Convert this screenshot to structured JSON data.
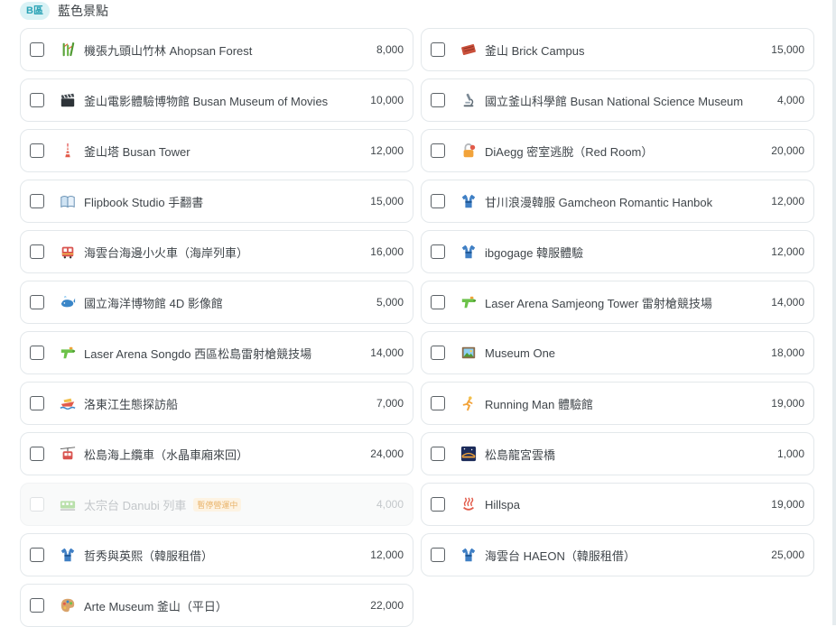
{
  "section": {
    "badge": "B區",
    "title": "藍色景點"
  },
  "status_tag_suspended": "暫停營運中",
  "items": [
    {
      "label": "機張九頭山竹林 Ahopsan Forest",
      "price": "8,000",
      "icon": "bamboo-icon",
      "disabled": false
    },
    {
      "label": "釜山 Brick Campus",
      "price": "15,000",
      "icon": "brick-icon",
      "disabled": false
    },
    {
      "label": "釜山電影體驗博物館 Busan Museum of Movies",
      "price": "10,000",
      "icon": "clapperboard-icon",
      "disabled": false
    },
    {
      "label": "國立釜山科學館 Busan National Science Museum",
      "price": "4,000",
      "icon": "microscope-icon",
      "disabled": false
    },
    {
      "label": "釜山塔 Busan Tower",
      "price": "12,000",
      "icon": "tower-icon",
      "disabled": false
    },
    {
      "label": "DiAegg 密室逃脫（Red Room）",
      "price": "20,000",
      "icon": "lock-icon",
      "disabled": false
    },
    {
      "label": "Flipbook Studio 手翻書",
      "price": "15,000",
      "icon": "book-icon",
      "disabled": false
    },
    {
      "label": "甘川浪漫韓服 Gamcheon Romantic Hanbok",
      "price": "12,000",
      "icon": "kimono-icon",
      "disabled": false
    },
    {
      "label": "海雲台海邊小火車（海岸列車）",
      "price": "16,000",
      "icon": "tram-icon",
      "disabled": false
    },
    {
      "label": "ibgogage 韓服體驗",
      "price": "12,000",
      "icon": "kimono-icon",
      "disabled": false
    },
    {
      "label": "國立海洋博物館 4D 影像館",
      "price": "5,000",
      "icon": "whale-icon",
      "disabled": false
    },
    {
      "label": "Laser Arena Samjeong Tower 雷射槍競技場",
      "price": "14,000",
      "icon": "water-gun-icon",
      "disabled": false
    },
    {
      "label": "Laser Arena Songdo 西區松島雷射槍競技場",
      "price": "14,000",
      "icon": "water-gun-icon",
      "disabled": false
    },
    {
      "label": "Museum One",
      "price": "18,000",
      "icon": "framed-picture-icon",
      "disabled": false
    },
    {
      "label": "洛東江生態探訪船",
      "price": "7,000",
      "icon": "boat-icon",
      "disabled": false
    },
    {
      "label": "Running Man 體驗館",
      "price": "19,000",
      "icon": "runner-icon",
      "disabled": false
    },
    {
      "label": "松島海上纜車（水晶車廂來回）",
      "price": "24,000",
      "icon": "cable-car-icon",
      "disabled": false
    },
    {
      "label": "松島龍宮雲橋",
      "price": "1,000",
      "icon": "bridge-night-icon",
      "disabled": false
    },
    {
      "label": "太宗台 Danubi 列車",
      "price": "4,000",
      "icon": "train-icon",
      "disabled": true
    },
    {
      "label": "Hillspa",
      "price": "19,000",
      "icon": "hot-springs-icon",
      "disabled": false
    },
    {
      "label": "哲秀與英熙（韓服租借）",
      "price": "12,000",
      "icon": "kimono-icon",
      "disabled": false
    },
    {
      "label": "海雲台 HAEON（韓服租借）",
      "price": "25,000",
      "icon": "kimono-icon",
      "disabled": false
    },
    {
      "label": "Arte Museum 釜山（平日）",
      "price": "22,000",
      "icon": "palette-icon",
      "disabled": false
    }
  ],
  "colors": {
    "badge_bg": "#d9f2f5",
    "badge_text": "#2aa3b6",
    "card_border": "#e3e8eb"
  }
}
